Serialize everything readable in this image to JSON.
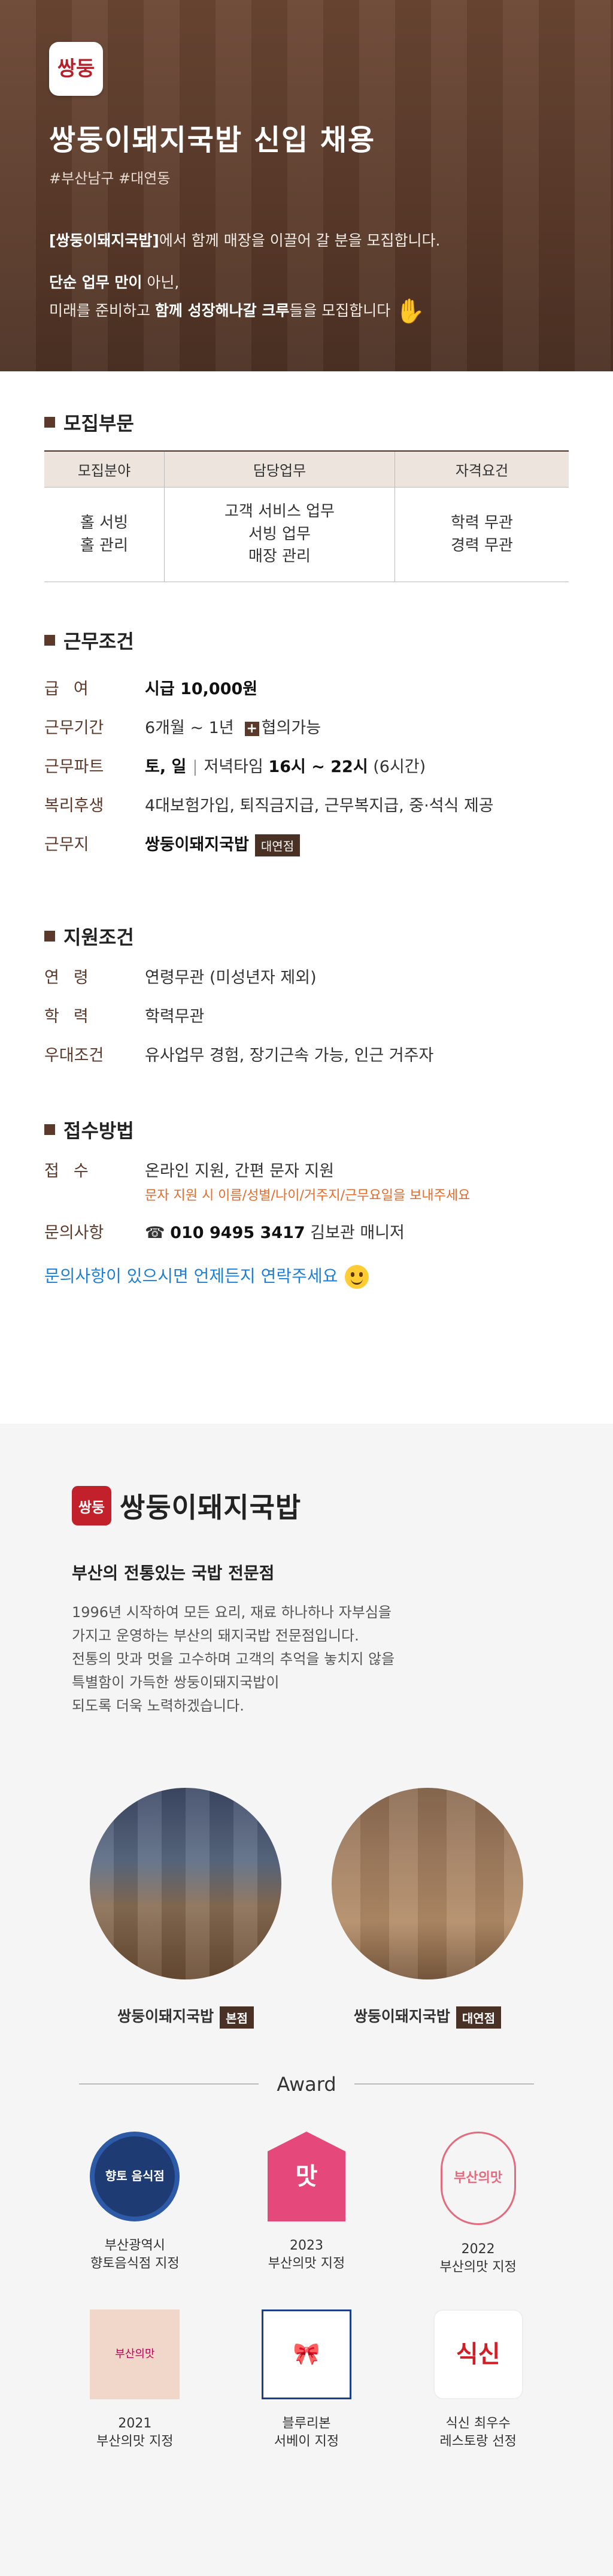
{
  "hero": {
    "logo_mark": "쌍둥",
    "title": "쌍둥이돼지국밥 신입 채용",
    "tags": "#부산남구 #대연동",
    "line1_bold": "[쌍둥이돼지국밥]",
    "line1_rest": "에서 함께 매장을 이끌어 갈 분을 모집합니다.",
    "line2_a": "단순 업무 만이",
    "line2_b": " 아닌,",
    "line3_a": "미래를 준비하고 ",
    "line3_b": "함께 성장해나갈 크루",
    "line3_c": "들을 모집합니다",
    "wave_icon": "✋"
  },
  "recruit": {
    "heading": "모집부문",
    "headers": [
      "모집분야",
      "담당업무",
      "자격요건"
    ],
    "cells": {
      "field": "홀 서빙\n홀 관리",
      "duty": "고객 서비스 업무\n서빙 업무\n매장 관리",
      "qual": "학력 무관\n경력 무관"
    }
  },
  "work": {
    "heading": "근무조건",
    "pay_k": "급여",
    "pay_v": "시급 10,000원",
    "period_k": "근무기간",
    "period_v": "6개월 ~ 1년",
    "period_plus": "+",
    "period_extra": "협의가능",
    "part_k": "근무파트",
    "part_days": "토, 일",
    "part_sep": "|",
    "part_time_a": "저녁타임 ",
    "part_time_b": "16시 ~ 22시",
    "part_time_c": " (6시간)",
    "benefit_k": "복리후생",
    "benefit_v": "4대보험가입, 퇴직금지급, 근무복지급, 중·석식 제공",
    "place_k": "근무지",
    "place_v": "쌍둥이돼지국밥",
    "place_badge": "대연점"
  },
  "apply": {
    "heading": "지원조건",
    "age_k": "연령",
    "age_v": "연령무관 (미성년자 제외)",
    "edu_k": "학력",
    "edu_v": "학력무관",
    "pref_k": "우대조건",
    "pref_v": "유사업무 경험, 장기근속 가능, 인근 거주자"
  },
  "receive": {
    "heading": "접수방법",
    "method_k": "접수",
    "method_v": "온라인 지원, 간편 문자 지원",
    "method_note": "문자 지원 시 이름/성별/나이/거주지/근무요일을 보내주세요",
    "contact_k": "문의사항",
    "contact_icon": "☎",
    "contact_num": "010 9495 3417",
    "contact_name": " 김보관 매니저",
    "cta": "문의사항이 있으시면 언제든지 연락주세요"
  },
  "about": {
    "brand_icon": "쌍둥",
    "brand_name": "쌍둥이돼지국밥",
    "heading": "부산의 전통있는 국밥 전문점",
    "desc": [
      "1996년 시작하여 모든 요리, 재료 하나하나 자부심을",
      "가지고 운영하는 부산의 돼지국밥 전문점입니다.",
      "전통의 맛과 멋을 고수하며 고객의 추억을 놓치지 않을",
      "특별함이 가득한 쌍둥이돼지국밥이",
      "되도록 더욱 노력하겠습니다."
    ],
    "stores": [
      {
        "name": "쌍둥이돼지국밥",
        "badge": "본점"
      },
      {
        "name": "쌍둥이돼지국밥",
        "badge": "대연점"
      }
    ],
    "award_title": "Award",
    "awards": [
      {
        "line1": "부산광역시",
        "line2": "향토음식점 지정",
        "img_text": "향토 음식점"
      },
      {
        "line1": "2023",
        "line2": "부산의맛 지정",
        "img_text": "맛"
      },
      {
        "line1": "2022",
        "line2": "부산의맛 지정",
        "img_text": "부산의맛"
      },
      {
        "line1": "2021",
        "line2": "부산의맛 지정",
        "img_text": "부산의맛"
      },
      {
        "line1": "블루리본",
        "line2": "서베이 지정",
        "img_text": "🎀"
      },
      {
        "line1": "식신 최우수",
        "line2": "레스토랑 선정",
        "img_text": "식신"
      }
    ]
  }
}
